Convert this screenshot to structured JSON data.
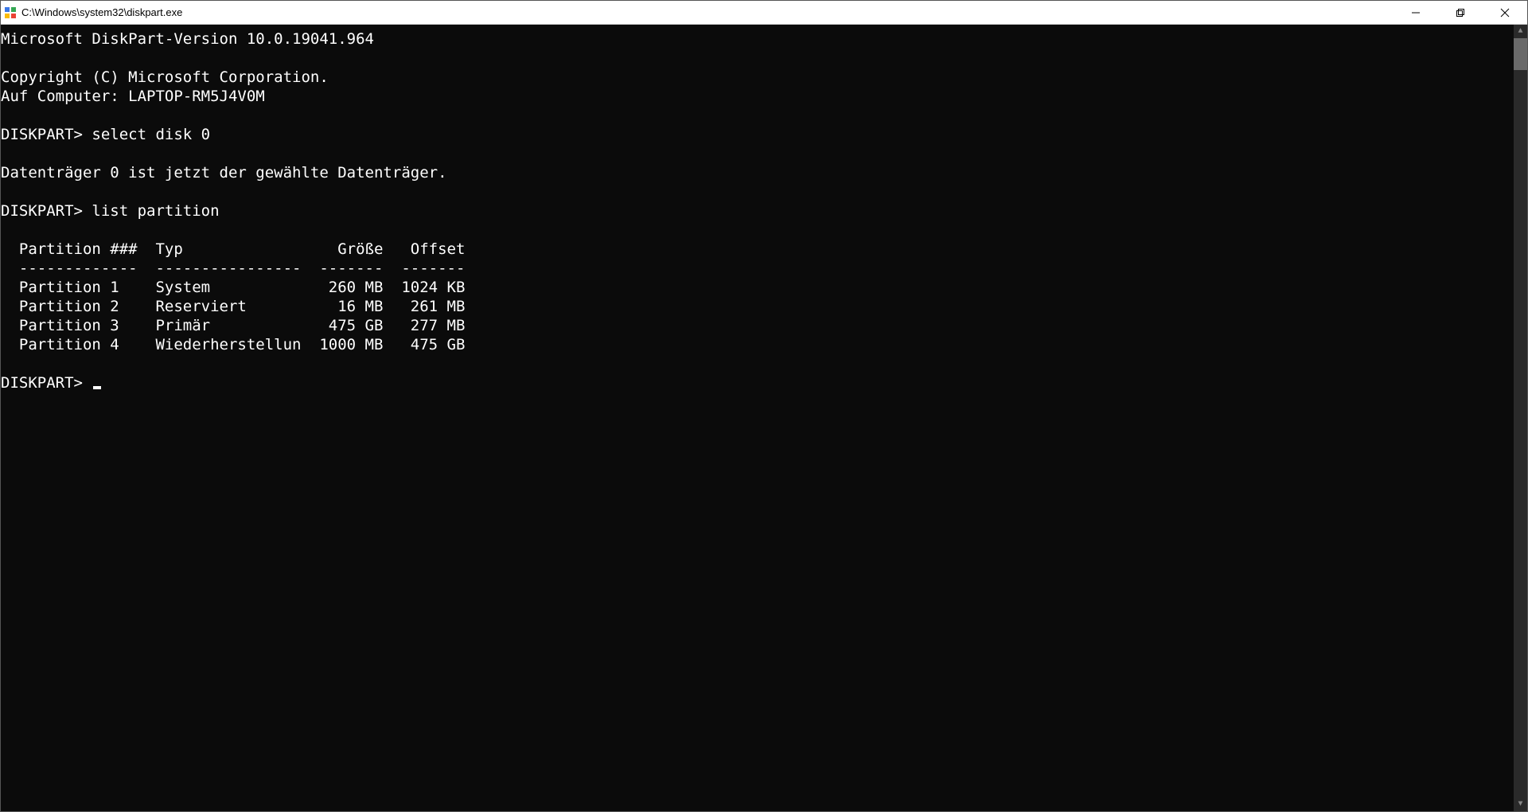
{
  "window": {
    "title": "C:\\Windows\\system32\\diskpart.exe"
  },
  "version_line": "Microsoft DiskPart-Version 10.0.19041.964",
  "copyright_line": "Copyright (C) Microsoft Corporation.",
  "computer_line": "Auf Computer: LAPTOP-RM5J4V0M",
  "prompt": "DISKPART>",
  "commands": {
    "cmd1": "select disk 0",
    "cmd1_response": "Datenträger 0 ist jetzt der gewählte Datenträger.",
    "cmd2": "list partition"
  },
  "table": {
    "header": {
      "col1": "Partition ###",
      "col2": "Typ",
      "col3": "Größe",
      "col4": "Offset"
    },
    "divider": {
      "col1": "-------------",
      "col2": "----------------",
      "col3": "-------",
      "col4": "-------"
    },
    "rows": [
      {
        "name": "Partition 1",
        "type": "System",
        "size": "260 MB",
        "offset": "1024 KB"
      },
      {
        "name": "Partition 2",
        "type": "Reserviert",
        "size": "16 MB",
        "offset": "261 MB"
      },
      {
        "name": "Partition 3",
        "type": "Primär",
        "size": "475 GB",
        "offset": "277 MB"
      },
      {
        "name": "Partition 4",
        "type": "Wiederherstellun",
        "size": "1000 MB",
        "offset": "475 GB"
      }
    ]
  }
}
